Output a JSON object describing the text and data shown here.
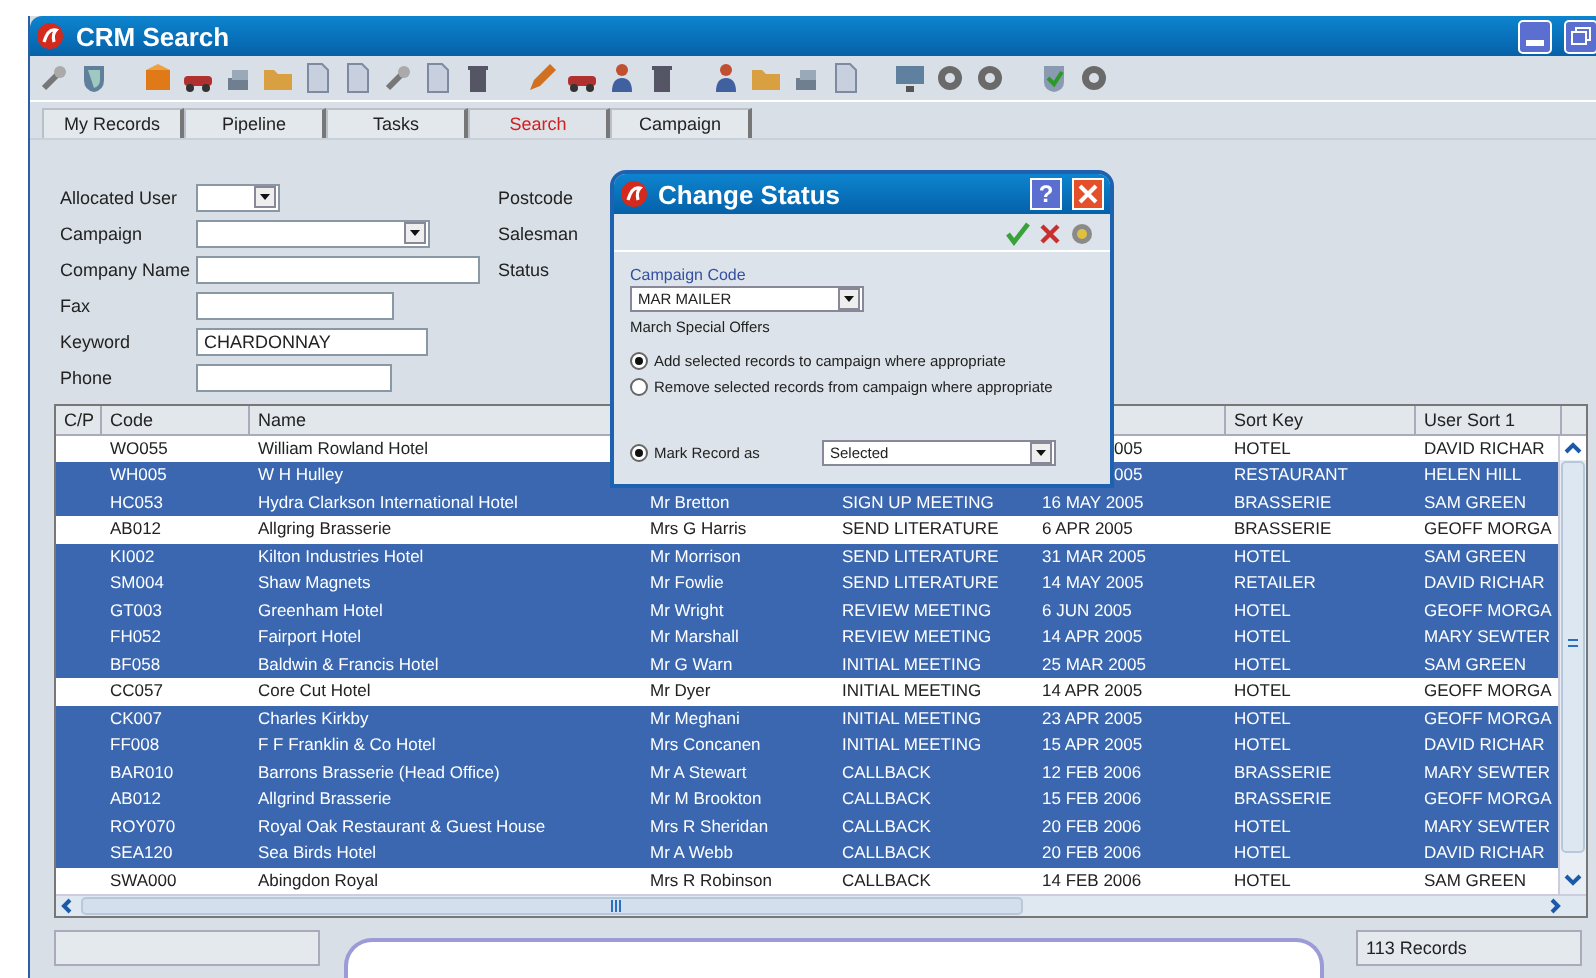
{
  "window": {
    "title": "CRM Search"
  },
  "tabs": [
    {
      "label": "My Records",
      "selected": false
    },
    {
      "label": "Pipeline",
      "selected": false
    },
    {
      "label": "Tasks",
      "selected": false
    },
    {
      "label": "Search",
      "selected": true
    },
    {
      "label": "Campaign",
      "selected": false
    }
  ],
  "search_form": {
    "fields": [
      {
        "label": "Allocated User",
        "kind": "dropdown"
      },
      {
        "label": "Campaign",
        "kind": "dropdown"
      },
      {
        "label": "Company Name",
        "kind": "text"
      },
      {
        "label": "Fax",
        "kind": "text"
      },
      {
        "label": "Keyword",
        "kind": "text",
        "value": "CHARDONNAY"
      },
      {
        "label": "Phone",
        "kind": "text"
      }
    ],
    "right_labels": [
      "Postcode",
      "Salesman",
      "Status"
    ]
  },
  "table": {
    "columns": [
      "C/P",
      "Code",
      "Name",
      "Sort Key",
      "User Sort 1"
    ],
    "rows": [
      {
        "code": "WO055",
        "name": "William Rowland Hotel",
        "column_6": "005",
        "sort_key": "HOTEL",
        "user_sort_1": "DAVID RICHAR",
        "selected": false
      },
      {
        "code": "WH005",
        "name": "W H Hulley",
        "column_6": "005",
        "sort_key": "RESTAURANT",
        "user_sort_1": "HELEN HILL",
        "selected": true
      },
      {
        "code": "HC053",
        "name": "Hydra Clarkson International Hotel",
        "column_4": "Mr Bretton",
        "column_5": "SIGN UP MEETING",
        "column_6": "16 MAY 2005",
        "sort_key": "BRASSERIE",
        "user_sort_1": "SAM GREEN",
        "selected": true
      },
      {
        "code": "AB012",
        "name": "Allgring Brasserie",
        "column_4": "Mrs G Harris",
        "column_5": "SEND LITERATURE",
        "column_6": "6 APR 2005",
        "sort_key": "BRASSERIE",
        "user_sort_1": "GEOFF MORGA",
        "selected": false
      },
      {
        "code": "KI002",
        "name": "Kilton Industries Hotel",
        "column_4": "Mr Morrison",
        "column_5": "SEND LITERATURE",
        "column_6": "31 MAR 2005",
        "sort_key": "HOTEL",
        "user_sort_1": "SAM GREEN",
        "selected": true
      },
      {
        "code": "SM004",
        "name": "Shaw Magnets",
        "column_4": "Mr Fowlie",
        "column_5": "SEND LITERATURE",
        "column_6": "14 MAY 2005",
        "sort_key": "RETAILER",
        "user_sort_1": "DAVID RICHAR",
        "selected": true
      },
      {
        "code": "GT003",
        "name": "Greenham Hotel",
        "column_4": "Mr Wright",
        "column_5": "REVIEW MEETING",
        "column_6": "6 JUN 2005",
        "sort_key": "HOTEL",
        "user_sort_1": "GEOFF MORGA",
        "selected": true
      },
      {
        "code": "FH052",
        "name": "Fairport Hotel",
        "column_4": "Mr Marshall",
        "column_5": "REVIEW MEETING",
        "column_6": "14 APR 2005",
        "sort_key": "HOTEL",
        "user_sort_1": "MARY SEWTER",
        "selected": true
      },
      {
        "code": "BF058",
        "name": "Baldwin & Francis Hotel",
        "column_4": "Mr G Warn",
        "column_5": "INITIAL MEETING",
        "column_6": "25 MAR 2005",
        "sort_key": "HOTEL",
        "user_sort_1": "SAM GREEN",
        "selected": true
      },
      {
        "code": "CC057",
        "name": "Core Cut Hotel",
        "column_4": "Mr Dyer",
        "column_5": "INITIAL MEETING",
        "column_6": "14 APR 2005",
        "sort_key": "HOTEL",
        "user_sort_1": "GEOFF MORGA",
        "selected": false
      },
      {
        "code": "CK007",
        "name": "Charles Kirkby",
        "column_4": "Mr Meghani",
        "column_5": "INITIAL MEETING",
        "column_6": "23 APR 2005",
        "sort_key": "HOTEL",
        "user_sort_1": "GEOFF MORGA",
        "selected": true
      },
      {
        "code": "FF008",
        "name": "F F Franklin & Co Hotel",
        "column_4": "Mrs Concanen",
        "column_5": "INITIAL MEETING",
        "column_6": "15 APR 2005",
        "sort_key": "HOTEL",
        "user_sort_1": "DAVID RICHAR",
        "selected": true
      },
      {
        "code": "BAR010",
        "name": "Barrons Brasserie (Head Office)",
        "column_4": "Mr A Stewart",
        "column_5": "CALLBACK",
        "column_6": "12 FEB 2006",
        "sort_key": "BRASSERIE",
        "user_sort_1": "MARY SEWTER",
        "selected": true
      },
      {
        "code": "AB012",
        "name": "Allgrind Brasserie",
        "column_4": "Mr M Brookton",
        "column_5": "CALLBACK",
        "column_6": "15 FEB 2006",
        "sort_key": "BRASSERIE",
        "user_sort_1": "GEOFF MORGA",
        "selected": true
      },
      {
        "code": "ROY070",
        "name": "Royal Oak Restaurant & Guest House",
        "column_4": "Mrs R Sheridan",
        "column_5": "CALLBACK",
        "column_6": "20 FEB 2006",
        "sort_key": "HOTEL",
        "user_sort_1": "MARY SEWTER",
        "selected": true
      },
      {
        "code": "SEA120",
        "name": "Sea Birds Hotel",
        "column_4": "Mr A Webb",
        "column_5": "CALLBACK",
        "column_6": "20 FEB 2006",
        "sort_key": "HOTEL",
        "user_sort_1": "DAVID RICHAR",
        "selected": true
      },
      {
        "code": "SWA000",
        "name": "Abingdon Royal",
        "column_4": "Mrs R Robinson",
        "column_5": "CALLBACK",
        "column_6": "14 FEB 2006",
        "sort_key": "HOTEL",
        "user_sort_1": "SAM GREEN",
        "selected": false
      }
    ]
  },
  "dialog": {
    "title": "Change Status",
    "help_button": "?",
    "campaign_code_label": "Campaign Code",
    "campaign_code": "MAR MAILER",
    "campaign_description": "March Special Offers",
    "options": [
      {
        "label": "Add selected records to campaign where appropriate",
        "selected": true
      },
      {
        "label": "Remove selected records from campaign where appropriate",
        "selected": false
      }
    ],
    "mark_record": {
      "label": "Mark Record as",
      "selected": true,
      "value": "Selected"
    }
  },
  "status_bar": {
    "record_count": "113 Records"
  }
}
